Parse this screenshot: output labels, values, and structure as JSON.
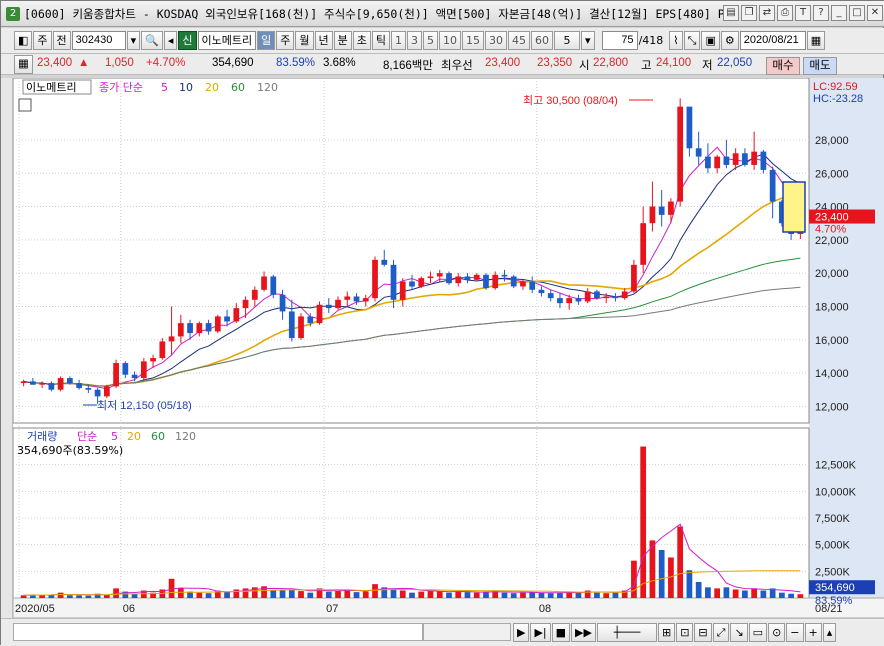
{
  "window": {
    "title": "[0600] 키움종합차트 - KOSDAQ 외국인보유[168(천)] 주식수[9,650(천)] 액면[500] 자본금[48(억)] 결산[12월] EPS[480] PER[4",
    "app_icon": "2"
  },
  "toolbar": {
    "period": "주",
    "prev": "전",
    "code": "302430",
    "shin": "신",
    "stock_name": "이노메트리",
    "day": "일",
    "week": "주",
    "month": "월",
    "year": "년",
    "minute": "분",
    "second": "초",
    "tick": "틱",
    "intervals": [
      "1",
      "3",
      "5",
      "10",
      "15",
      "30",
      "45",
      "60"
    ],
    "interval_sel": "5",
    "count": "75",
    "total": "/418",
    "date": "2020/08/21"
  },
  "quote": {
    "price": "23,400",
    "change": "1,050",
    "pct": "+4.70%",
    "volume": "354,690",
    "vol_ratio": "83.59%",
    "turnover": "3.68%",
    "amount": "8,166백만",
    "best_label": "최우선",
    "ask": "23,400",
    "bid": "23,350",
    "open_label": "시",
    "open": "22,800",
    "high_label": "고",
    "high": "24,100",
    "low_label": "저",
    "low": "22,050",
    "buy": "매수",
    "sell": "매도"
  },
  "price_panel": {
    "legend_name": "이노메트리",
    "ma_label": "종가 단순",
    "ma_periods": [
      "5",
      "10",
      "20",
      "60",
      "120"
    ],
    "ma_colors": [
      "#d21ec8",
      "#1c2e7a",
      "#e3a800",
      "#25913a",
      "#7a7a7a"
    ],
    "lc": "LC:92.59",
    "hc": "HC:-23.28",
    "max_label": "최고 30,500 (08/04)",
    "min_label": "최저 12,150 (05/18)",
    "last_price": "23,400",
    "last_pct": "4.70%",
    "y_ticks": [
      "28,000",
      "26,000",
      "24,000",
      "22,000",
      "20,000",
      "18,000",
      "16,000",
      "14,000",
      "12,000"
    ]
  },
  "volume_panel": {
    "legend_name": "거래량",
    "ma_label": "단순",
    "ma_periods": [
      "5",
      "20",
      "60",
      "120"
    ],
    "info": "354,690주(83.59%)",
    "y_ticks": [
      "12,500K",
      "10,000K",
      "7,500K",
      "5,000K",
      "2,500K"
    ],
    "last_vol": "354,690",
    "last_pct": "83.59%"
  },
  "x_axis": [
    "2020/05",
    "06",
    "07",
    "08",
    "08/21"
  ],
  "colors": {
    "up": "#e8141c",
    "down": "#1e5cc8",
    "axis_bg": "#dce6f4"
  },
  "chart_data": {
    "type": "candlestick",
    "ylim": [
      11000,
      31000
    ],
    "candles": [
      [
        13400,
        13600,
        13200,
        13500
      ],
      [
        13500,
        13700,
        13300,
        13300
      ],
      [
        13300,
        13500,
        13100,
        13400
      ],
      [
        13400,
        13500,
        12900,
        13000
      ],
      [
        13000,
        13800,
        12900,
        13700
      ],
      [
        13700,
        13800,
        13300,
        13400
      ],
      [
        13400,
        13600,
        13000,
        13100
      ],
      [
        13100,
        13300,
        12800,
        13000
      ],
      [
        13000,
        13100,
        12150,
        12600
      ],
      [
        12600,
        13300,
        12500,
        13200
      ],
      [
        13200,
        14800,
        13100,
        14600
      ],
      [
        14600,
        14700,
        13700,
        13900
      ],
      [
        13900,
        14100,
        13500,
        13700
      ],
      [
        13700,
        14900,
        13600,
        14700
      ],
      [
        14700,
        15100,
        14300,
        14900
      ],
      [
        14900,
        16100,
        14800,
        15900
      ],
      [
        15900,
        18000,
        15100,
        16200
      ],
      [
        16200,
        17500,
        15800,
        17000
      ],
      [
        17000,
        17200,
        16000,
        16400
      ],
      [
        16400,
        17100,
        16200,
        17000
      ],
      [
        17000,
        17200,
        16300,
        16500
      ],
      [
        16500,
        17500,
        16400,
        17400
      ],
      [
        17400,
        17800,
        16800,
        17100
      ],
      [
        17100,
        18200,
        17000,
        17900
      ],
      [
        17900,
        18600,
        17300,
        18400
      ],
      [
        18400,
        19200,
        18000,
        19000
      ],
      [
        19000,
        20100,
        18900,
        19800
      ],
      [
        19800,
        19900,
        18500,
        18700
      ],
      [
        18700,
        19000,
        17200,
        17700
      ],
      [
        17700,
        18400,
        15900,
        16100
      ],
      [
        16100,
        17600,
        16000,
        17400
      ],
      [
        17400,
        17600,
        16800,
        17000
      ],
      [
        17000,
        18300,
        16900,
        18100
      ],
      [
        18100,
        18500,
        17600,
        17900
      ],
      [
        17900,
        18600,
        17800,
        18400
      ],
      [
        18400,
        18900,
        18000,
        18600
      ],
      [
        18600,
        18800,
        18100,
        18300
      ],
      [
        18300,
        18700,
        18000,
        18500
      ],
      [
        18500,
        21000,
        18300,
        20800
      ],
      [
        20800,
        21400,
        20400,
        20500
      ],
      [
        20500,
        20800,
        17900,
        18400
      ],
      [
        18400,
        19700,
        18000,
        19500
      ],
      [
        19500,
        19900,
        19000,
        19200
      ],
      [
        19200,
        19800,
        19100,
        19700
      ],
      [
        19700,
        20100,
        19400,
        19800
      ],
      [
        19800,
        20200,
        19500,
        20000
      ],
      [
        20000,
        20100,
        19300,
        19400
      ],
      [
        19400,
        20000,
        19200,
        19800
      ],
      [
        19800,
        20000,
        19400,
        19600
      ],
      [
        19600,
        20000,
        19500,
        19900
      ],
      [
        19900,
        20000,
        19000,
        19100
      ],
      [
        19100,
        20100,
        19000,
        19900
      ],
      [
        19900,
        20200,
        19500,
        19800
      ],
      [
        19800,
        19900,
        19100,
        19200
      ],
      [
        19200,
        19600,
        19000,
        19500
      ],
      [
        19500,
        19800,
        18800,
        19000
      ],
      [
        19000,
        19200,
        18600,
        18800
      ],
      [
        18800,
        19000,
        18300,
        18500
      ],
      [
        18500,
        18800,
        17900,
        18200
      ],
      [
        18200,
        18700,
        17800,
        18500
      ],
      [
        18500,
        18700,
        18100,
        18300
      ],
      [
        18300,
        19100,
        18200,
        18900
      ],
      [
        18900,
        19000,
        18400,
        18500
      ],
      [
        18500,
        18800,
        18200,
        18600
      ],
      [
        18600,
        18800,
        18300,
        18500
      ],
      [
        18500,
        19100,
        18400,
        18900
      ],
      [
        18900,
        20800,
        18800,
        20500
      ],
      [
        20500,
        24000,
        20000,
        23000
      ],
      [
        23000,
        25500,
        22500,
        24000
      ],
      [
        24000,
        25000,
        22800,
        23500
      ],
      [
        23500,
        24500,
        23000,
        24300
      ],
      [
        24300,
        30500,
        24000,
        30000
      ],
      [
        30000,
        29000,
        27000,
        27500
      ],
      [
        27500,
        28500,
        26500,
        27000
      ],
      [
        27000,
        27800,
        26000,
        26300
      ],
      [
        26300,
        27100,
        26000,
        27000
      ],
      [
        27000,
        28000,
        26300,
        26500
      ],
      [
        26500,
        27500,
        26200,
        27200
      ],
      [
        27200,
        27500,
        26400,
        26500
      ],
      [
        26500,
        28500,
        26200,
        27300
      ],
      [
        27300,
        27400,
        26000,
        26200
      ],
      [
        26200,
        26400,
        23300,
        24300
      ],
      [
        24300,
        24400,
        22800,
        23000
      ],
      [
        23000,
        23200,
        22000,
        22350
      ],
      [
        22350,
        24100,
        22050,
        23400
      ]
    ],
    "ma5": [],
    "volumes_k": [
      250,
      300,
      280,
      320,
      500,
      260,
      240,
      220,
      400,
      300,
      900,
      600,
      400,
      700,
      500,
      800,
      1800,
      900,
      600,
      500,
      450,
      700,
      600,
      800,
      900,
      1000,
      1100,
      700,
      700,
      800,
      650,
      500,
      900,
      600,
      700,
      800,
      550,
      600,
      1300,
      1000,
      900,
      700,
      500,
      600,
      700,
      650,
      500,
      600,
      550,
      500,
      600,
      700,
      500,
      450,
      500,
      550,
      500,
      450,
      500,
      600,
      500,
      700,
      500,
      450,
      500,
      700,
      3500,
      14200,
      5400,
      4500,
      3800,
      6700,
      2600,
      1500,
      1000,
      900,
      1000,
      800,
      700,
      900,
      700,
      900,
      500,
      400,
      354
    ]
  }
}
